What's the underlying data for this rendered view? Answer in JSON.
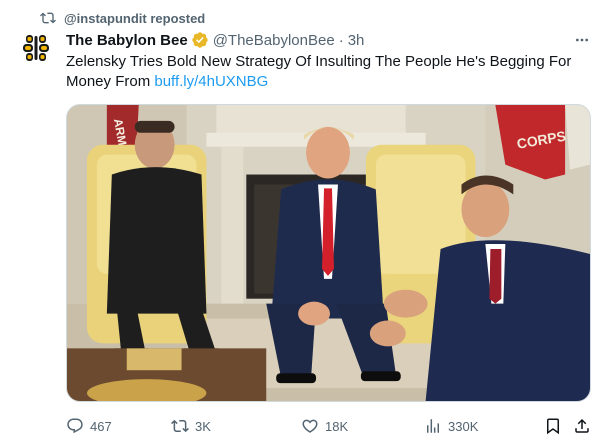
{
  "repost": {
    "text": "@instapundit reposted"
  },
  "author": {
    "name": "The Babylon Bee",
    "handle": "@TheBabylonBee",
    "separator": "·",
    "time": "3h"
  },
  "tweet": {
    "text": "Zelensky Tries Bold New Strategy Of Insulting The People He's Begging For Money From ",
    "link": "buff.ly/4hUXNBG"
  },
  "media": {
    "flag_text_left": "ARM",
    "flag_text_right": "CORPS"
  },
  "actions": {
    "replies": "467",
    "reposts": "3K",
    "likes": "18K",
    "views": "330K"
  },
  "colors": {
    "accent": "#1d9bf0",
    "secondary_text": "#536471",
    "verified_gold": "#e8b829",
    "brand": "#f2b705"
  }
}
